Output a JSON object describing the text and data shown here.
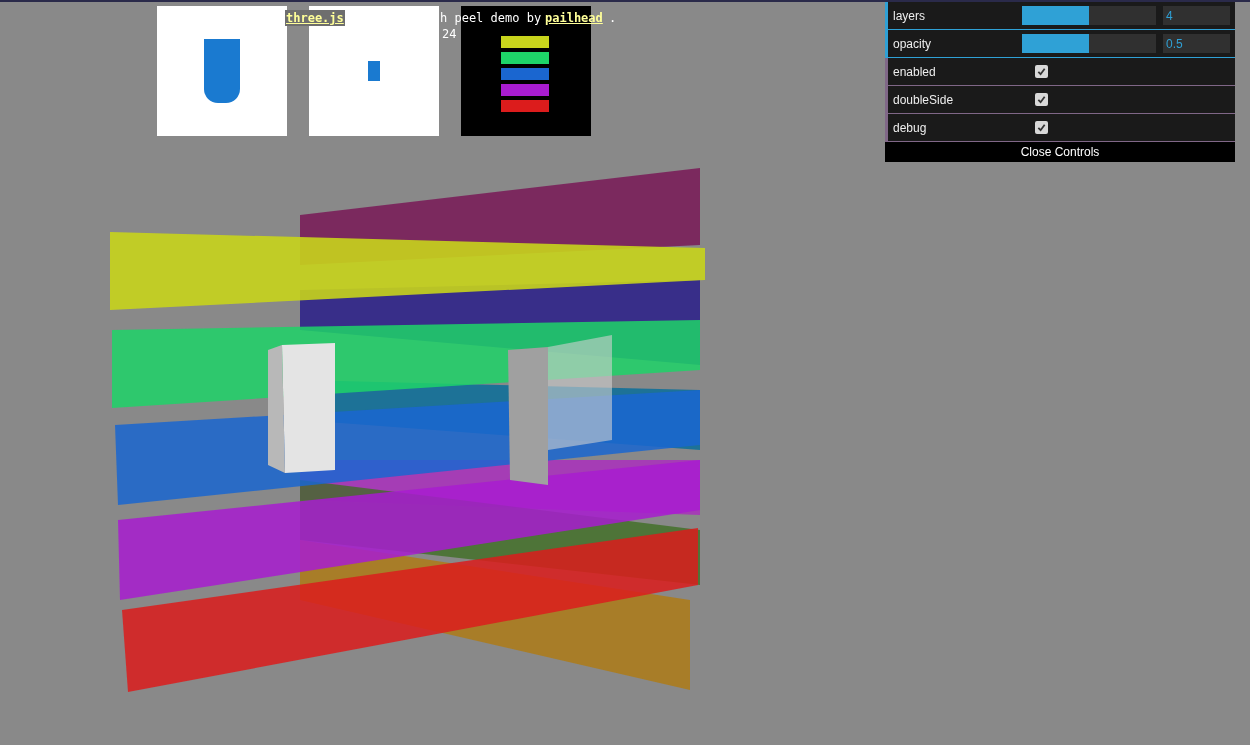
{
  "info": {
    "parts": [
      {
        "kind": "link",
        "text": "three.js"
      },
      {
        "kind": "text",
        "text": "h peel demo by"
      },
      {
        "kind": "link",
        "text": "pailhead"
      },
      {
        "kind": "text",
        "text": "."
      }
    ],
    "line_2": "24"
  },
  "gui": {
    "controls": [
      {
        "kind": "slider",
        "label": "layers",
        "level": 0.5,
        "value": "4"
      },
      {
        "kind": "slider",
        "label": "opacity",
        "level": 0.5,
        "value": "0.5"
      },
      {
        "kind": "checkbox",
        "label": "enabled",
        "checked": true
      },
      {
        "kind": "checkbox",
        "label": "doubleSide",
        "checked": true
      },
      {
        "kind": "checkbox",
        "label": "debug",
        "checked": true
      }
    ],
    "close_button": "Close Controls"
  }
}
